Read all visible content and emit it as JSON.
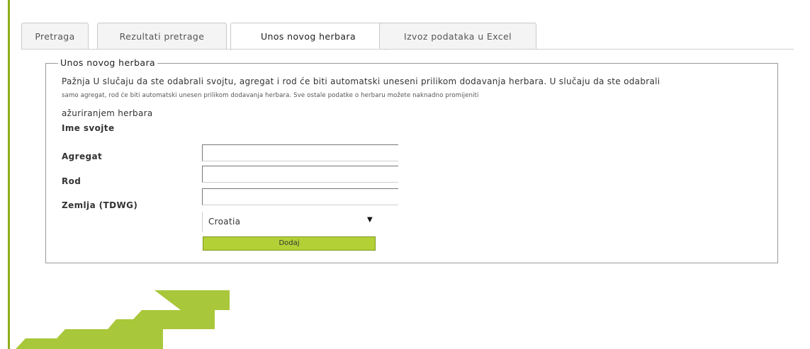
{
  "tabs": [
    {
      "label": "Pretraga",
      "active": false
    },
    {
      "label": "Rezultati pretrage",
      "active": false
    },
    {
      "label": "Unos novog herbara",
      "active": true
    },
    {
      "label": "Izvoz podataka u Excel",
      "active": false
    }
  ],
  "form": {
    "legend": "Unos novog herbara",
    "note_line1": "Pažnja U slučaju da ste odabrali svojtu, agregat i rod će biti automatski uneseni prilikom dodavanja herbara. U slučaju da ste odabrali",
    "note_line2": "samo agregat, rod će biti automatski unesen prilikom dodavanja herbara. Sve ostale podatke o herbaru možete naknadno promijeniti",
    "note_line3": "ažuriranjem herbara",
    "fields": {
      "ime_svojte": {
        "label": "Ime svojte",
        "value": ""
      },
      "agregat": {
        "label": "Agregat",
        "value": ""
      },
      "rod": {
        "label": "Rod",
        "value": ""
      },
      "zemlja": {
        "label": "Zemlja (TDWG)",
        "value": "Croatia"
      }
    },
    "submit_label": "Dodaj"
  },
  "colors": {
    "accent": "#8fae1b",
    "button": "#b3d136",
    "arrow": "#a9c73a"
  },
  "icons": {
    "dropdown": "chevron-down-icon",
    "decor": "arrow-up-right-icon"
  }
}
